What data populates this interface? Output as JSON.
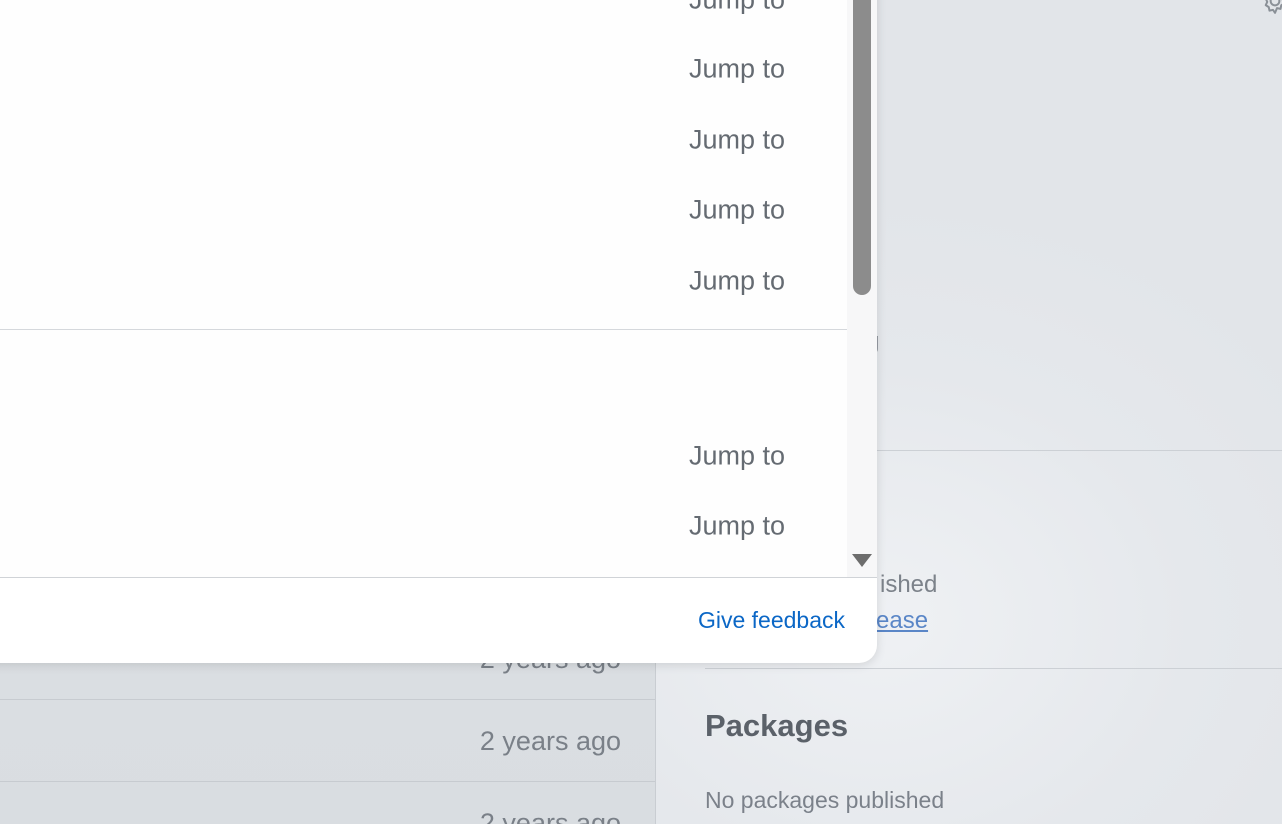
{
  "background": {
    "repo_rows": [
      {
        "time": "2 years ago"
      },
      {
        "time": "2 years ago"
      },
      {
        "time": "2 years ago"
      }
    ],
    "sidebar": {
      "partial_fragment_1": "g",
      "partial_fragment_2": "ished",
      "partial_link_fragment": "ease",
      "packages_title": "Packages",
      "packages_empty": "No packages published"
    },
    "icons": {
      "gear": "gear-icon"
    }
  },
  "dropdown": {
    "items": [
      {
        "label": "Jump to"
      },
      {
        "label": "Jump to"
      },
      {
        "label": "Jump to"
      },
      {
        "label": "Jump to"
      },
      {
        "label": "Jump to"
      },
      {
        "label": "Jump to"
      },
      {
        "label": "Jump to"
      }
    ],
    "footer": {
      "feedback_label": "Give feedback"
    },
    "colors": {
      "link": "#0b67c6",
      "scrollbar_thumb": "#8c8c8c"
    }
  }
}
